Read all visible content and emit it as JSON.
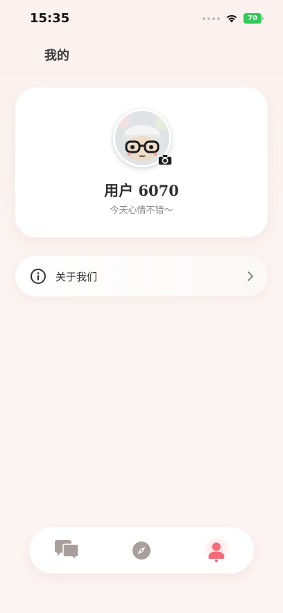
{
  "status_bar": {
    "time": "15:35",
    "battery": "70"
  },
  "header": {
    "title": "我的"
  },
  "profile": {
    "username": "用户 6070",
    "bio": "今天心情不错～"
  },
  "menu": {
    "about_label": "关于我们"
  },
  "nav": {
    "items": [
      {
        "icon": "chat-bubbles-icon",
        "active": false
      },
      {
        "icon": "compass-icon",
        "active": false
      },
      {
        "icon": "person-icon",
        "active": true
      }
    ]
  },
  "colors": {
    "accent": "#f26b78",
    "battery_green": "#35c759",
    "icon_gray": "#a89f9d",
    "background": "#fcf4f2"
  }
}
